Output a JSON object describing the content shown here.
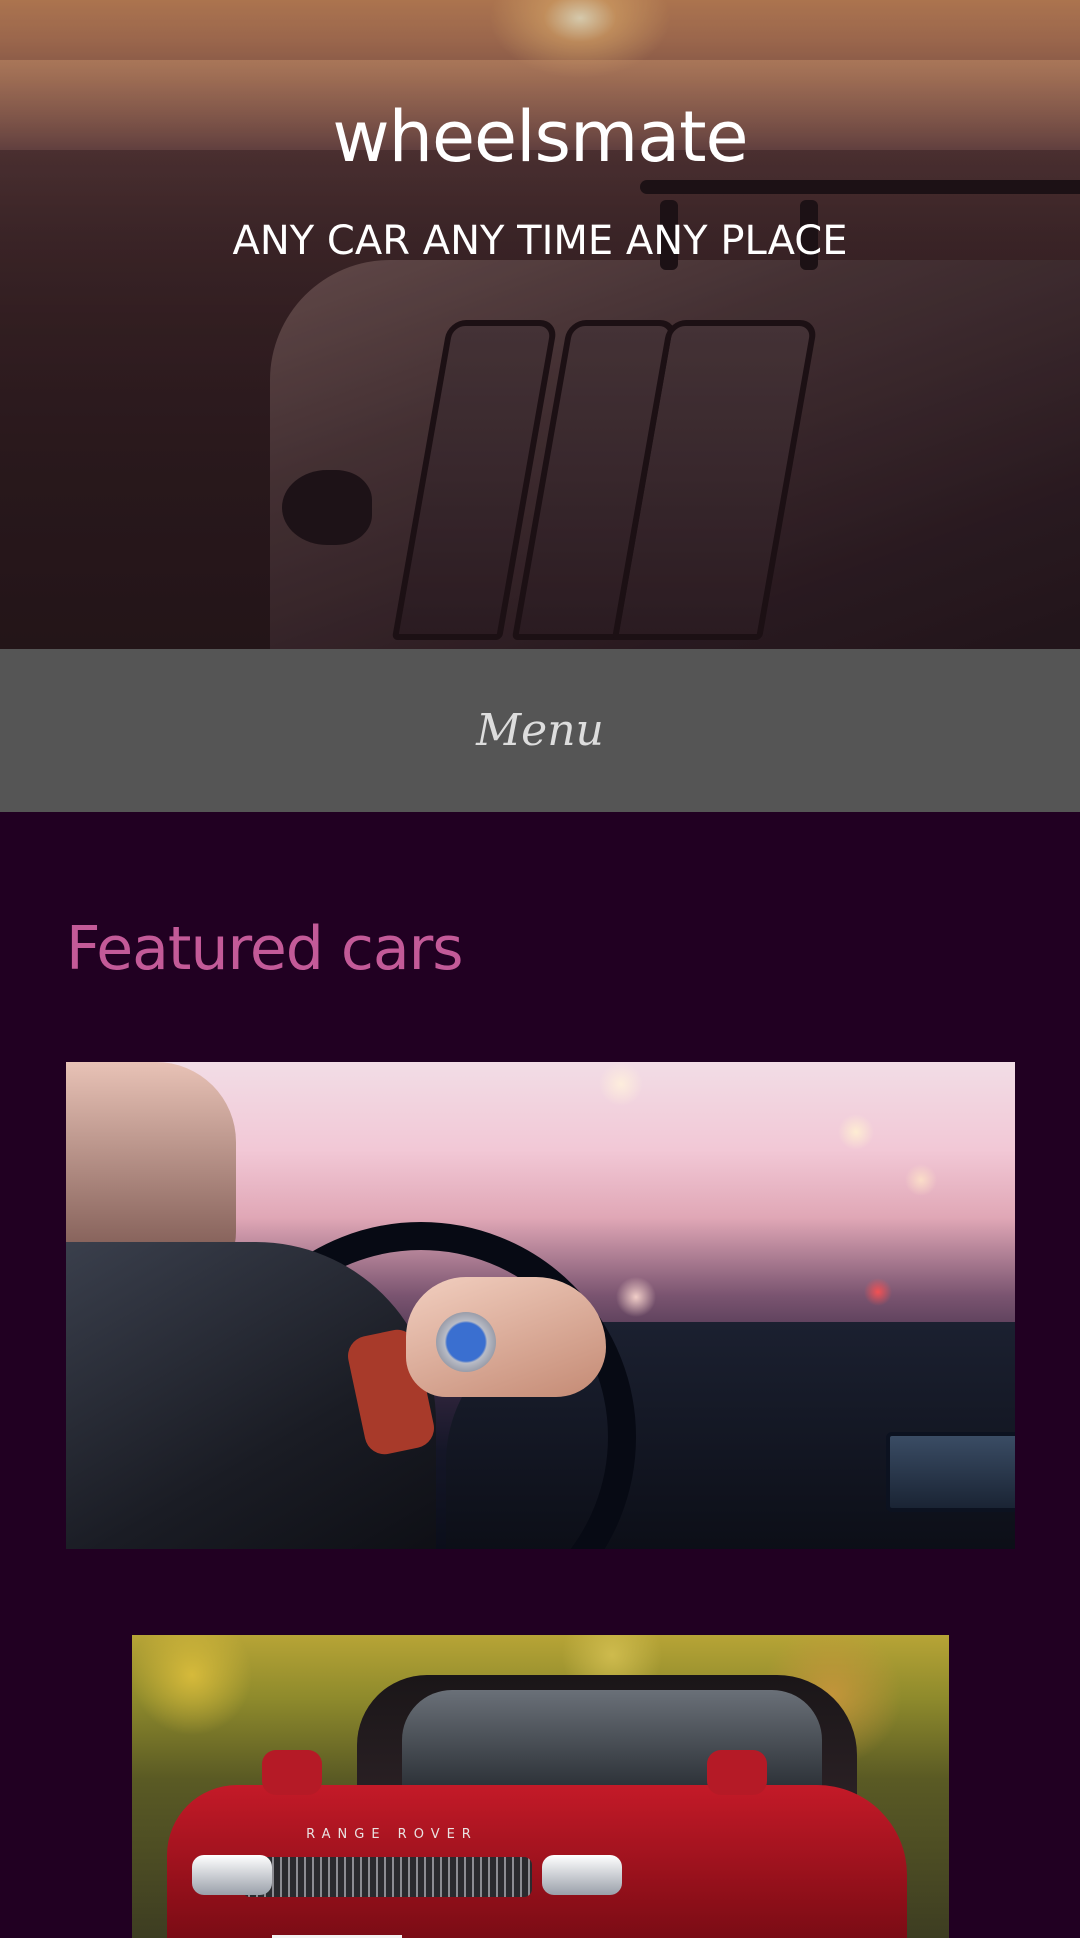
{
  "header": {
    "site_title": "wheelsmate",
    "tagline": "ANY CAR ANY TIME ANY PLACE"
  },
  "nav": {
    "menu_label": "Menu"
  },
  "main": {
    "section_title": "Featured cars",
    "images": [
      {
        "name": "featured-driving-image"
      },
      {
        "name": "range-rover-image"
      }
    ]
  },
  "colors": {
    "page_background": "#210022",
    "menu_background": "#555555",
    "section_title": "#c35a98",
    "header_text": "#ffffff"
  }
}
